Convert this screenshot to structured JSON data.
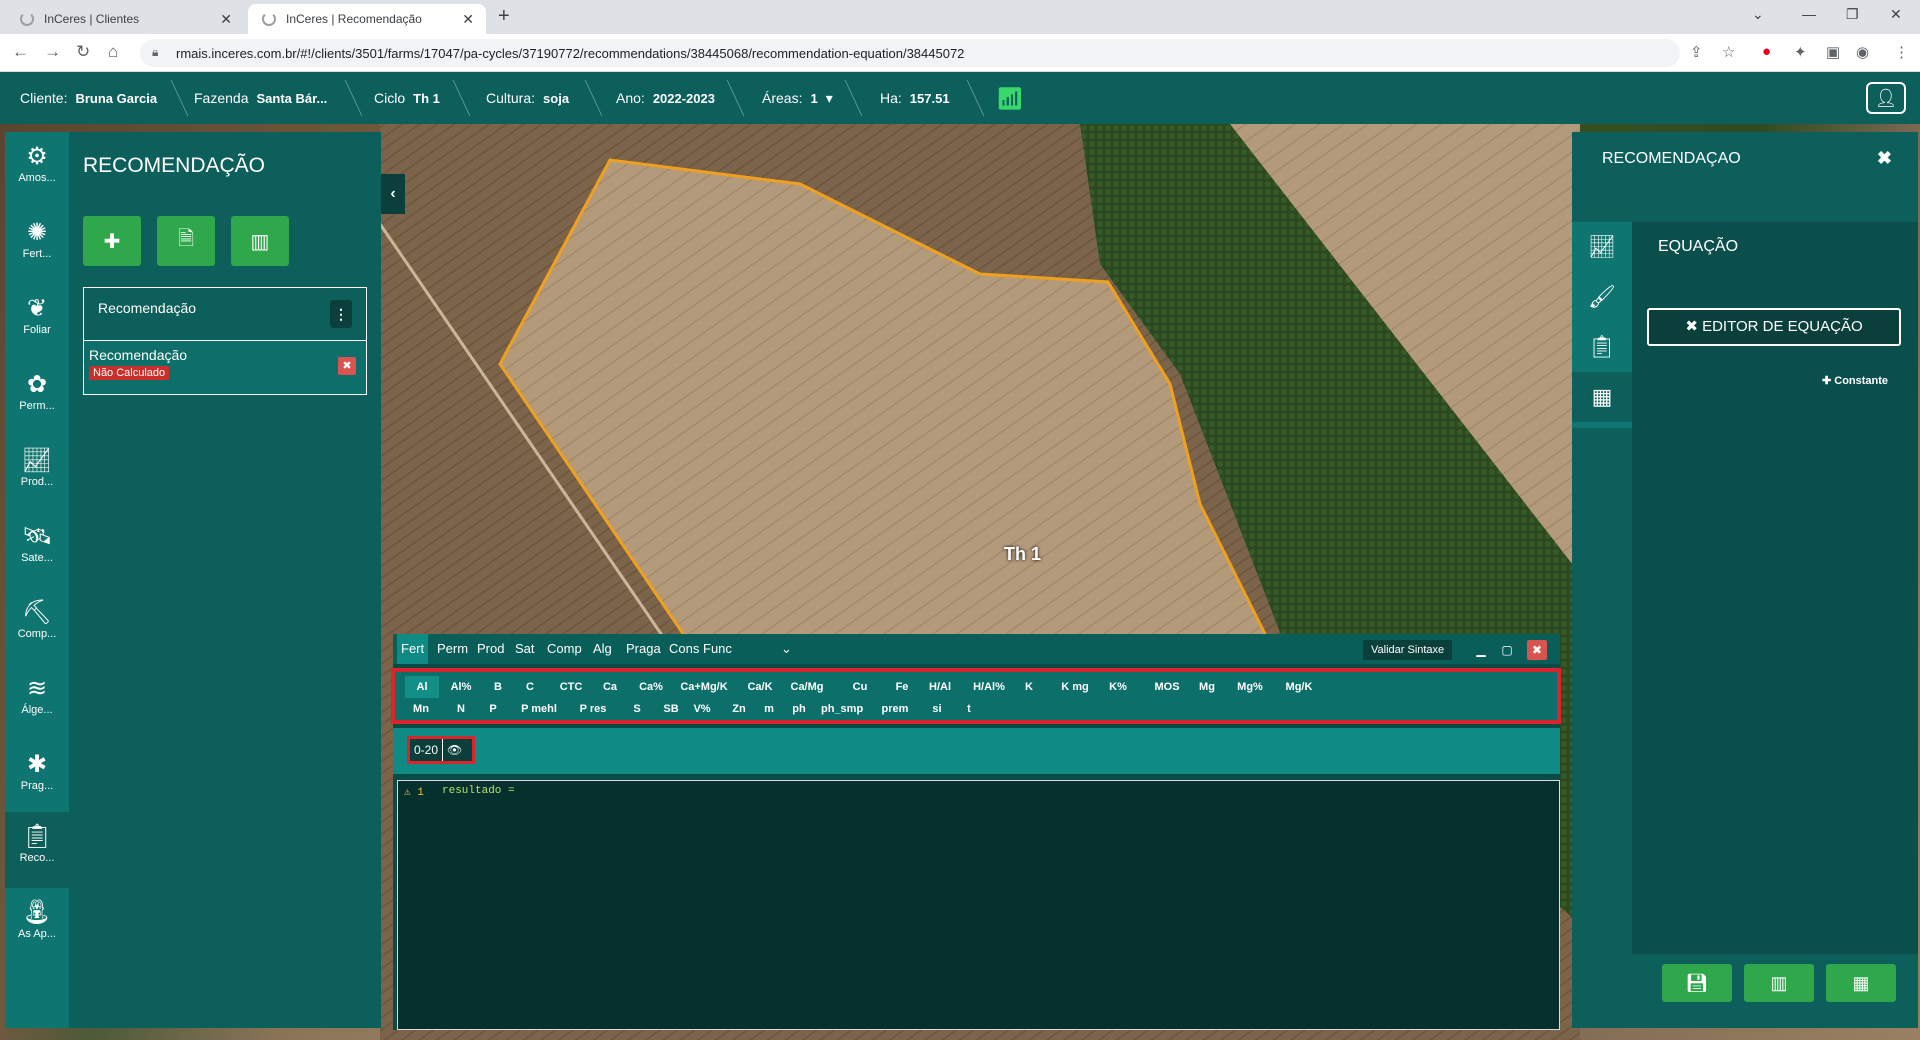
{
  "browser": {
    "tabs": [
      {
        "title": "InCeres | Clientes"
      },
      {
        "title": "InCeres | Recomendação"
      }
    ],
    "url": "rmais.inceres.com.br/#!/clients/3501/farms/17047/pa-cycles/37190772/recommendations/38445068/recommendation-equation/38445072"
  },
  "appbar": {
    "cliente_label": "Cliente:",
    "cliente_value": "Bruna Garcia",
    "fazenda_label": "Fazenda",
    "fazenda_value": "Santa Bár...",
    "ciclo_label": "Ciclo",
    "ciclo_value": "Th 1",
    "cultura_label": "Cultura:",
    "cultura_value": "soja",
    "ano_label": "Ano:",
    "ano_value": "2022-2023",
    "areas_label": "Áreas:",
    "areas_value": "1",
    "ha_label": "Ha:",
    "ha_value": "157.51"
  },
  "rail": [
    {
      "label": "Amos...",
      "icon": "sample-icon"
    },
    {
      "label": "Fert...",
      "icon": "fertilizer-icon"
    },
    {
      "label": "Foliar",
      "icon": "leaf-icon"
    },
    {
      "label": "Perm...",
      "icon": "plant-icon"
    },
    {
      "label": "Prod...",
      "icon": "chart-icon"
    },
    {
      "label": "Sate...",
      "icon": "satellite-icon"
    },
    {
      "label": "Comp...",
      "icon": "compaction-icon"
    },
    {
      "label": "Álge...",
      "icon": "layers-icon"
    },
    {
      "label": "Prag...",
      "icon": "bug-icon"
    },
    {
      "label": "Reco...",
      "icon": "recommendation-icon"
    },
    {
      "label": "As Ap...",
      "icon": "sprayer-icon"
    }
  ],
  "left_panel": {
    "title": "RECOMENDAÇÃO",
    "list_header": "Recomendação",
    "item_name": "Recomendação",
    "item_status": "Não Calculado"
  },
  "map": {
    "field_label": "Th 1"
  },
  "editor": {
    "tabs": [
      "Fert",
      "Perm",
      "Prod",
      "Sat",
      "Comp",
      "Alg",
      "Praga",
      "Cons",
      "Func"
    ],
    "validate_label": "Validar Sintaxe",
    "variables_row1": [
      "Al",
      "Al%",
      "B",
      "C",
      "CTC",
      "Ca",
      "Ca%",
      "Ca+Mg/K",
      "Ca/K",
      "Ca/Mg",
      "Cu",
      "Fe",
      "H/Al",
      "H/Al%",
      "K",
      "K mg",
      "K%",
      "MOS",
      "Mg",
      "Mg%",
      "Mg/K"
    ],
    "variables_row2": [
      "Mn",
      "N",
      "P",
      "P mehl",
      "P res",
      "S",
      "SB",
      "V%",
      "Zn",
      "m",
      "ph",
      "ph_smp",
      "prem",
      "si",
      "t"
    ],
    "depth": "0-20",
    "line_number": "1",
    "code": "resultado ="
  },
  "right_panel": {
    "title": "RECOMENDAÇAO",
    "section": "EQUAÇÃO",
    "editor_button": "✖ EDITOR DE EQUAÇÃO",
    "constant_button": "✚ Constante"
  },
  "colors": {
    "teal": "#0c5f5b",
    "green": "#2ea84a",
    "red": "#d9242c"
  }
}
